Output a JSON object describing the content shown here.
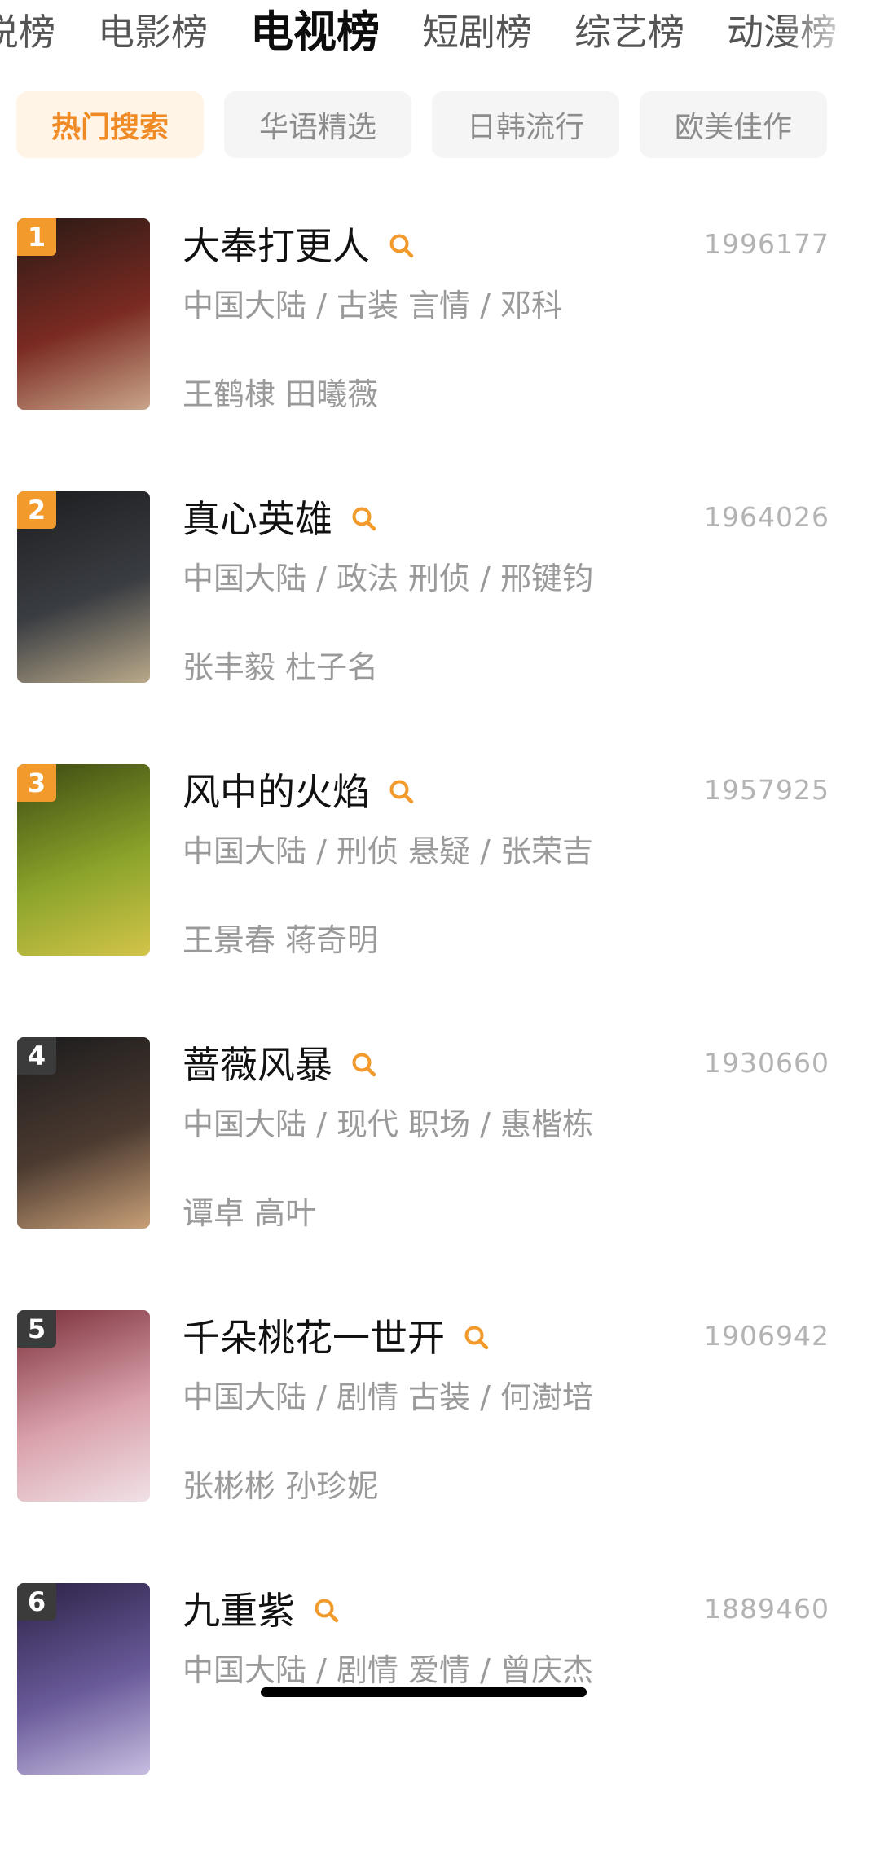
{
  "top_tabs": [
    "说榜",
    "电影榜",
    "电视榜",
    "短剧榜",
    "综艺榜",
    "动漫榜"
  ],
  "top_tab_active": "电视榜",
  "chips": [
    "热门搜索",
    "华语精选",
    "日韩流行",
    "欧美佳作"
  ],
  "chip_active": "热门搜索",
  "colors": {
    "accent": "#f39a2c",
    "chip_active_bg": "#fff4e6",
    "chip_bg": "#f5f5f5",
    "muted_text": "#9a9a9a"
  },
  "items": [
    {
      "rank": "1",
      "title": "大奉打更人",
      "score": "1996177",
      "meta": "中国大陆 / 古装 言情 / 邓科",
      "cast": "王鹤棣 田曦薇",
      "poster_palette": [
        "#2a1a15",
        "#7a2a22",
        "#c9a58a"
      ],
      "badge_style": "top"
    },
    {
      "rank": "2",
      "title": "真心英雄",
      "score": "1964026",
      "meta": "中国大陆 / 政法 刑侦 / 邢键钧",
      "cast": "张丰毅 杜子名",
      "poster_palette": [
        "#1c1d1f",
        "#3a3d42",
        "#b9a98a"
      ],
      "badge_style": "top"
    },
    {
      "rank": "3",
      "title": "风中的火焰",
      "score": "1957925",
      "meta": "中国大陆 / 刑侦 悬疑 / 张荣吉",
      "cast": "王景春 蒋奇明",
      "poster_palette": [
        "#3d4a12",
        "#8aa32a",
        "#d3c44a"
      ],
      "badge_style": "top"
    },
    {
      "rank": "4",
      "title": "蔷薇风暴",
      "score": "1930660",
      "meta": "中国大陆 / 现代 职场 / 惠楷栋",
      "cast": "谭卓 高叶",
      "poster_palette": [
        "#1b1b1d",
        "#4b3a30",
        "#c9a078"
      ],
      "badge_style": "normal"
    },
    {
      "rank": "5",
      "title": "千朵桃花一世开",
      "score": "1906942",
      "meta": "中国大陆 / 剧情 古装 / 何澍培",
      "cast": "张彬彬 孙珍妮",
      "poster_palette": [
        "#7a2f3a",
        "#d9a0aa",
        "#f0e1e6"
      ],
      "badge_style": "normal"
    },
    {
      "rank": "6",
      "title": "九重紫",
      "score": "1889460",
      "meta": "中国大陆 / 剧情 爱情 / 曾庆杰",
      "cast": "",
      "poster_palette": [
        "#2b2246",
        "#6a5a9a",
        "#c7bde0"
      ],
      "badge_style": "normal"
    }
  ]
}
